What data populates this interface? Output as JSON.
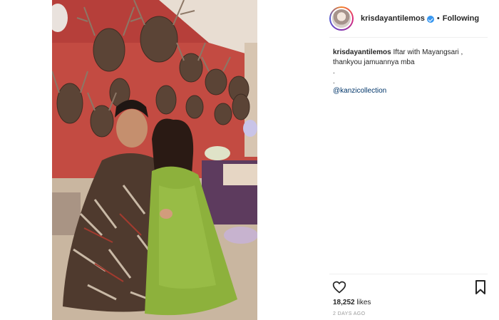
{
  "post": {
    "username": "krisdayantilemos",
    "verified": true,
    "separator": "•",
    "follow_status": "Following",
    "caption": {
      "username": "krisdayantilemos",
      "text_line1": "Iftar with Mayangsari ,",
      "text_line2": "thankyou jamuannya mba",
      "dot_line1": ".",
      "dot_line2": ".",
      "mention": "@kanzicollection"
    },
    "likes_count": "18,252",
    "likes_label": "likes",
    "timestamp": "2 DAYS AGO",
    "image_icon": "photo-two-women-seated-before-antler-trophy-wall"
  },
  "colors": {
    "verified_badge": "#3897f0",
    "mention": "#003569",
    "wall_red": "#c4493f",
    "green_dress": "#8fb23a"
  }
}
